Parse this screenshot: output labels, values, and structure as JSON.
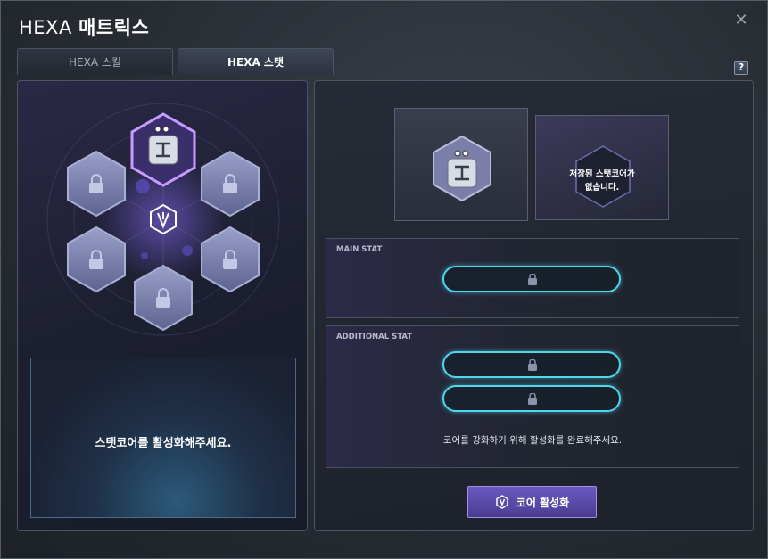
{
  "window": {
    "title_prefix": "HEXA",
    "title_main": "매트릭스",
    "close_label": "✕",
    "help_label": "?"
  },
  "tabs": [
    {
      "label": "HEXA 스킬",
      "active": false
    },
    {
      "label": "HEXA 스탯",
      "active": true
    }
  ],
  "left": {
    "center_emblem": "hexa-logo-icon",
    "core_slots": [
      {
        "state": "active",
        "icon": "stat-core-icon"
      },
      {
        "state": "locked",
        "icon": "lock-icon"
      },
      {
        "state": "locked",
        "icon": "lock-icon"
      },
      {
        "state": "locked",
        "icon": "lock-icon"
      },
      {
        "state": "locked",
        "icon": "lock-icon"
      },
      {
        "state": "locked",
        "icon": "lock-icon"
      },
      {
        "state": "locked",
        "icon": "lock-icon"
      }
    ],
    "description": "스탯코어를 활성화해주세요."
  },
  "right": {
    "equipped_core_icon": "stat-core-icon",
    "saved_core_text_1": "저장된 스탯코어가",
    "saved_core_text_2": "없습니다.",
    "main_stat_label": "MAIN STAT",
    "additional_stat_label": "ADDITIONAL STAT",
    "additional_note": "코어를 강화하기 위해 활성화를 완료해주세요.",
    "activate_label": "코어 활성화"
  },
  "colors": {
    "accent_purple": "#6a5ac0",
    "slot_glow": "#4fd8ec",
    "active_core_border": "#c89cff"
  }
}
